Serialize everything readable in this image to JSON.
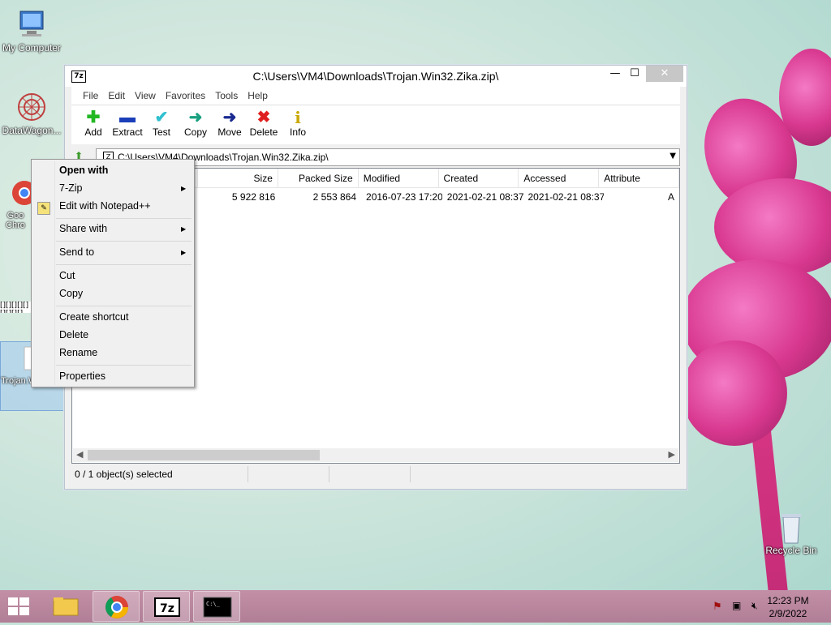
{
  "desktop": {
    "icons": [
      {
        "label": "My Computer"
      },
      {
        "label": "DataWagon..."
      },
      {
        "label": "Goo Chro"
      },
      {
        "label": "Trojan.Win32.Zika"
      },
      {
        "label": "Recycle Bin"
      }
    ],
    "partial_label": "[][][][][][][][][]"
  },
  "window": {
    "title": "C:\\Users\\VM4\\Downloads\\Trojan.Win32.Zika.zip\\",
    "app_icon": "7z",
    "controls": {
      "minimize": "—",
      "maximize": "☐",
      "close": "✕"
    },
    "menu": [
      "File",
      "Edit",
      "View",
      "Favorites",
      "Tools",
      "Help"
    ],
    "toolbar": [
      {
        "label": "Add",
        "icon": "plus-icon",
        "glyph": "✚",
        "color": "#22b822"
      },
      {
        "label": "Extract",
        "icon": "minus-icon",
        "glyph": "▬",
        "color": "#1a3fb8"
      },
      {
        "label": "Test",
        "icon": "check-icon",
        "glyph": "✔",
        "color": "#30c0d0"
      },
      {
        "label": "Copy",
        "icon": "copy-arrow-icon",
        "glyph": "➜",
        "color": "#18a080"
      },
      {
        "label": "Move",
        "icon": "move-arrow-icon",
        "glyph": "➜",
        "color": "#1a2a90"
      },
      {
        "label": "Delete",
        "icon": "delete-x-icon",
        "glyph": "✖",
        "color": "#e02020"
      },
      {
        "label": "Info",
        "icon": "info-icon",
        "glyph": "i",
        "color": "#c8a800"
      }
    ],
    "address": "C:\\Users\\VM4\\Downloads\\Trojan.Win32.Zika.zip\\",
    "columns": [
      "Size",
      "Packed Size",
      "Modified",
      "Created",
      "Accessed",
      "Attribute"
    ],
    "rows": [
      {
        "size": "5 922 816",
        "packed": "2 553 864",
        "modified": "2016-07-23 17:20",
        "created": "2021-02-21 08:37",
        "accessed": "2021-02-21 08:37",
        "attr": "A"
      }
    ],
    "status": "0 / 1 object(s) selected"
  },
  "context_menu": {
    "items": [
      {
        "label": "Open with",
        "bold": true
      },
      {
        "label": "7-Zip",
        "submenu": true
      },
      {
        "label": "Edit with Notepad++"
      },
      {
        "label": "Share with",
        "submenu": true
      },
      {
        "label": "Send to",
        "submenu": true
      },
      {
        "label": "Cut"
      },
      {
        "label": "Copy"
      },
      {
        "label": "Create shortcut"
      },
      {
        "label": "Delete"
      },
      {
        "label": "Rename"
      },
      {
        "label": "Properties"
      }
    ]
  },
  "taskbar": {
    "apps": [
      "File Explorer",
      "Google Chrome",
      "7-Zip File Manager",
      "Command Prompt"
    ],
    "time": "12:23 PM",
    "date": "2/9/2022"
  }
}
